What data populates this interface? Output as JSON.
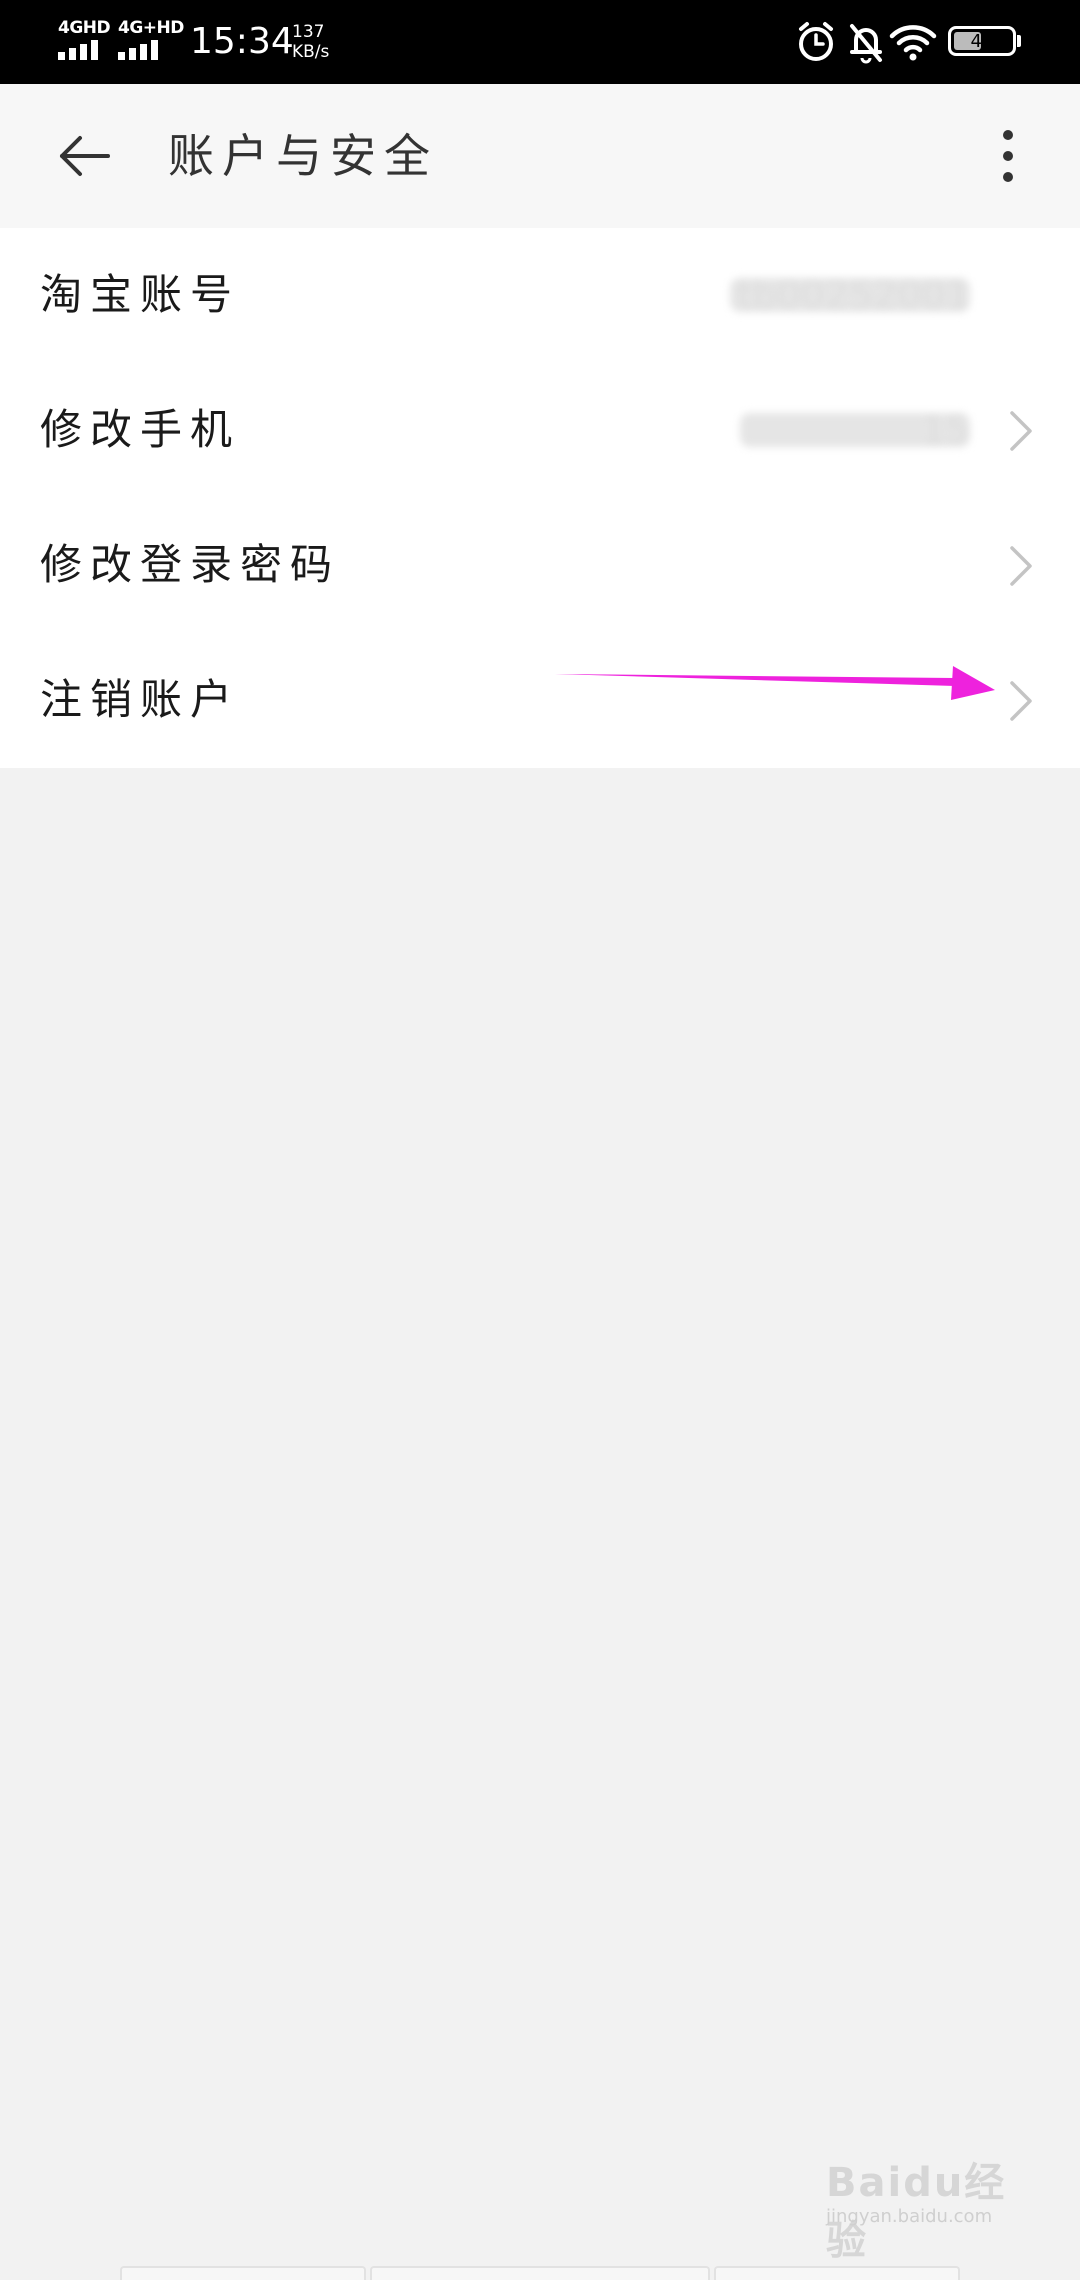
{
  "status_bar": {
    "sim1_label": "4GHD",
    "sim2_label": "4G+HD",
    "time": "15:34",
    "speed_value": "137",
    "speed_unit": "KB/s",
    "battery": "49",
    "icons": [
      "alarm-icon",
      "bell-muted-icon",
      "wifi-icon",
      "battery-icon"
    ]
  },
  "header": {
    "title": "账户与安全",
    "back_icon": "back-arrow-icon",
    "more_icon": "more-vertical-icon"
  },
  "list": {
    "items": [
      {
        "label": "淘宝账号",
        "value": "tb00252001",
        "has_chevron": false
      },
      {
        "label": "修改手机",
        "value": "15",
        "has_chevron": true
      },
      {
        "label": "修改登录密码",
        "value": "",
        "has_chevron": true
      },
      {
        "label": "注销账户",
        "value": "",
        "has_chevron": true
      }
    ]
  },
  "annotation": {
    "color": "#ee22dd"
  },
  "watermark": {
    "brand": "Baidu经验",
    "url": "jingyan.baidu.com"
  }
}
